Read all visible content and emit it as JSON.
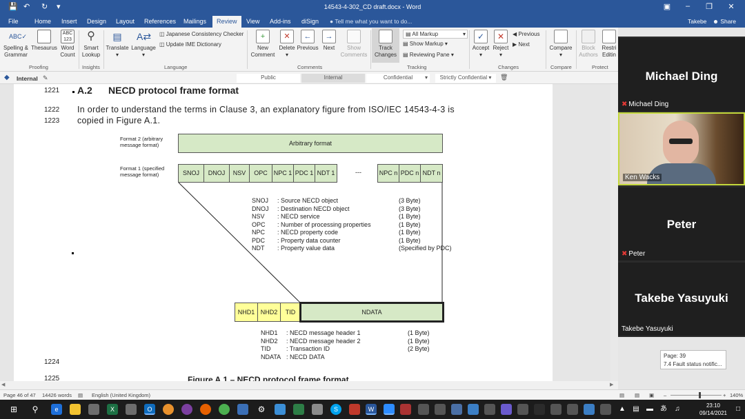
{
  "window": {
    "title": "14543-4-302_CD draft.docx - Word",
    "user": "Takebe",
    "share_label": "Share"
  },
  "tabs": [
    "File",
    "Home",
    "Insert",
    "Design",
    "Layout",
    "References",
    "Mailings",
    "Review",
    "View",
    "Add-ins",
    "diSign"
  ],
  "active_tab": "Review",
  "tell_me": "Tell me what you want to do...",
  "ribbon": {
    "proofing": {
      "spelling": "Spelling &",
      "grammar": "Grammar",
      "thesaurus": "Thesaurus",
      "word": "Word",
      "count": "Count",
      "label": "Proofing"
    },
    "insights": {
      "smart": "Smart",
      "lookup": "Lookup",
      "label": "Insights"
    },
    "language": {
      "translate": "Translate",
      "language": "Language",
      "jcc": "Japanese Consistency Checker",
      "ime": "Update IME Dictionary",
      "label": "Language"
    },
    "comments": {
      "new1": "New",
      "new2": "Comment",
      "delete": "Delete",
      "previous": "Previous",
      "next": "Next",
      "show1": "Show",
      "show2": "Comments",
      "label": "Comments"
    },
    "tracking": {
      "track1": "Track",
      "track2": "Changes",
      "markup_select": "All Markup",
      "show_markup": "Show Markup",
      "reviewing_pane": "Reviewing Pane",
      "label": "Tracking"
    },
    "changes": {
      "accept": "Accept",
      "reject": "Reject",
      "previous": "Previous",
      "next": "Next",
      "label": "Changes"
    },
    "compare": {
      "compare": "Compare",
      "label": "Compare"
    },
    "protect": {
      "block1": "Block",
      "block2": "Authors",
      "restrict1": "Restri",
      "restrict2": "Editin",
      "label": "Protect"
    }
  },
  "sensitivity": {
    "current": "Internal",
    "options": [
      "Public",
      "Internal",
      "Confidential",
      "Strictly Confidential"
    ]
  },
  "document": {
    "lines": {
      "l1221": "1221",
      "l1222": "1222",
      "l1223": "1223",
      "l1224": "1224",
      "l1225": "1225"
    },
    "heading_num": "A.2",
    "heading_text": "NECD protocol frame format",
    "para_line1": "In order to understand the terms in Clause 3, an explanatory figure from ISO/IEC 14543-4-3 is",
    "para_line2": "copied in Figure A.1.",
    "caption": "Figure A.1 – NECD protocol frame format",
    "figure": {
      "format2_label": "Format 2 (arbitrary message format)",
      "format1_label": "Format 1 (specified message format)",
      "arbitrary": "Arbitrary format",
      "fields_top": [
        "SNOJ",
        "DNOJ",
        "NSV",
        "OPC",
        "NPC 1",
        "PDC 1",
        "NDT 1"
      ],
      "ellipsis": "---",
      "fields_top_right": [
        "NPC n",
        "PDC n",
        "NDT n"
      ],
      "legend1": [
        {
          "abbr": "SNOJ",
          "desc": ": Source NECD object",
          "size": "(3 Byte)"
        },
        {
          "abbr": "DNOJ",
          "desc": ": Destination NECD object",
          "size": "(3 Byte)"
        },
        {
          "abbr": "NSV",
          "desc": ": NECD service",
          "size": "(1 Byte)"
        },
        {
          "abbr": "OPC",
          "desc": ": Number of processing properties",
          "size": "(1 Byte)"
        },
        {
          "abbr": "NPC",
          "desc": ": NECD property code",
          "size": "(1 Byte)"
        },
        {
          "abbr": "PDC",
          "desc": ": Property data counter",
          "size": "(1 Byte)"
        },
        {
          "abbr": "NDT",
          "desc": ": Property value data",
          "size": "(Specified by PDC)"
        }
      ],
      "fields_bottom": [
        "NHD1",
        "NHD2",
        "TID"
      ],
      "ndata": "NDATA",
      "legend2": [
        {
          "abbr": "NHD1",
          "desc": ": NECD message header 1",
          "size": "(1 Byte)"
        },
        {
          "abbr": "NHD2",
          "desc": ": NECD message header 2",
          "size": "(1 Byte)"
        },
        {
          "abbr": "TID",
          "desc": ": Transaction ID",
          "size": "(2 Byte)"
        },
        {
          "abbr": "NDATA",
          "desc": ": NECD DATA",
          "size": ""
        }
      ]
    }
  },
  "participants": [
    {
      "name": "Michael Ding",
      "label": "Michael Ding",
      "video": false,
      "muted": true
    },
    {
      "name": "",
      "label": "Ken Wacks",
      "video": true,
      "muted": false
    },
    {
      "name": "Peter",
      "label": "Peter",
      "video": false,
      "muted": true
    },
    {
      "name": "Takebe Yasuyuki",
      "label": "Takebe Yasuyuki",
      "video": false,
      "muted": false
    }
  ],
  "page_tooltip": {
    "page": "Page: 39",
    "section": "7.4 Fault status notific..."
  },
  "status": {
    "page": "Page 46 of 47",
    "words": "14426 words",
    "language": "English (United Kingdom)",
    "zoom": "140%"
  },
  "clock": {
    "time": "23:10",
    "date": "09/14/2021"
  },
  "colors": {
    "word_blue": "#2b579a",
    "figure_green": "#d6e9c6",
    "figure_yellow": "#ffff99"
  }
}
